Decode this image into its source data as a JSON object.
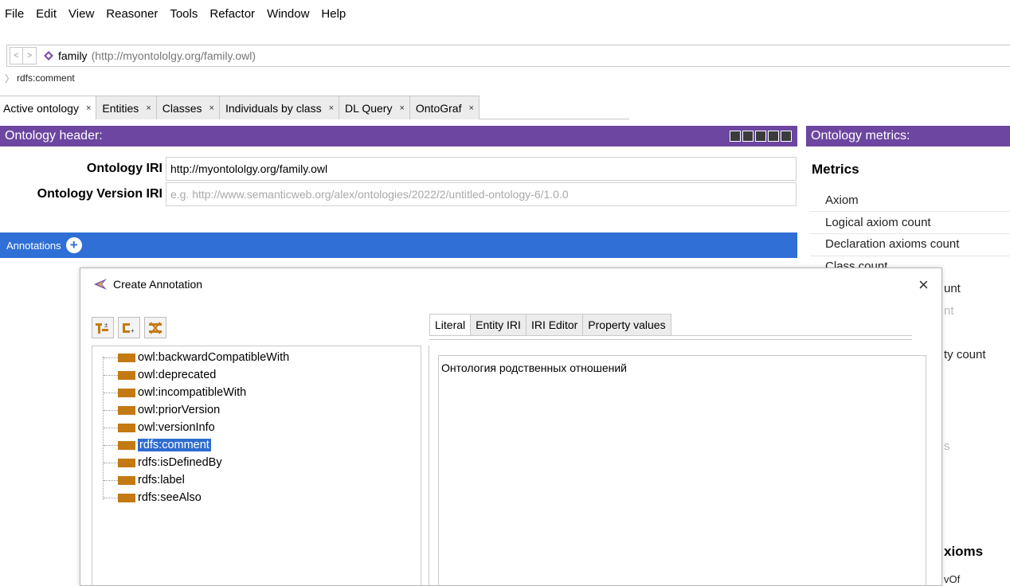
{
  "menu": [
    "File",
    "Edit",
    "View",
    "Reasoner",
    "Tools",
    "Refactor",
    "Window",
    "Help"
  ],
  "address": {
    "back": "<",
    "forward": ">",
    "ontology_name": "family",
    "ontology_iri": "(http://myontololgy.org/family.owl)"
  },
  "breadcrumb": "rdfs:comment",
  "tabs": [
    {
      "label": "Active ontology",
      "close": "×"
    },
    {
      "label": "Entities",
      "close": "×"
    },
    {
      "label": "Classes",
      "close": "×"
    },
    {
      "label": "Individuals by class",
      "close": "×"
    },
    {
      "label": "DL Query",
      "close": "×"
    },
    {
      "label": "OntoGraf",
      "close": "×"
    }
  ],
  "ontology_header": {
    "title": "Ontology header:",
    "iri_label": "Ontology IRI",
    "iri_value": "http://myontololgy.org/family.owl",
    "version_label": "Ontology Version IRI",
    "version_placeholder": "e.g. http://www.semanticweb.org/alex/ontologies/2022/2/untitled-ontology-6/1.0.0",
    "annotations_label": "Annotations",
    "annotations_add": "+"
  },
  "metrics": {
    "title": "Ontology metrics:",
    "heading": "Metrics",
    "rows": [
      "Axiom",
      "Logical axiom count",
      "Declaration axioms count",
      "Class count"
    ],
    "partial": [
      "unt",
      "nt",
      "ty count",
      "s",
      "xioms",
      "vOf"
    ]
  },
  "dialog": {
    "title": "Create Annotation",
    "close": "×",
    "properties": [
      "owl:backwardCompatibleWith",
      "owl:deprecated",
      "owl:incompatibleWith",
      "owl:priorVersion",
      "owl:versionInfo",
      "rdfs:comment",
      "rdfs:isDefinedBy",
      "rdfs:label",
      "rdfs:seeAlso"
    ],
    "selected_property": "rdfs:comment",
    "value_tabs": [
      "Literal",
      "Entity IRI",
      "IRI Editor",
      "Property values"
    ],
    "literal_value": "Онтология родственных отношений"
  },
  "colors": {
    "header_purple": "#6c46a0",
    "annotations_blue": "#2f6fd6",
    "property_swatch": "#c47a12",
    "selection": "#2e6cd0"
  }
}
